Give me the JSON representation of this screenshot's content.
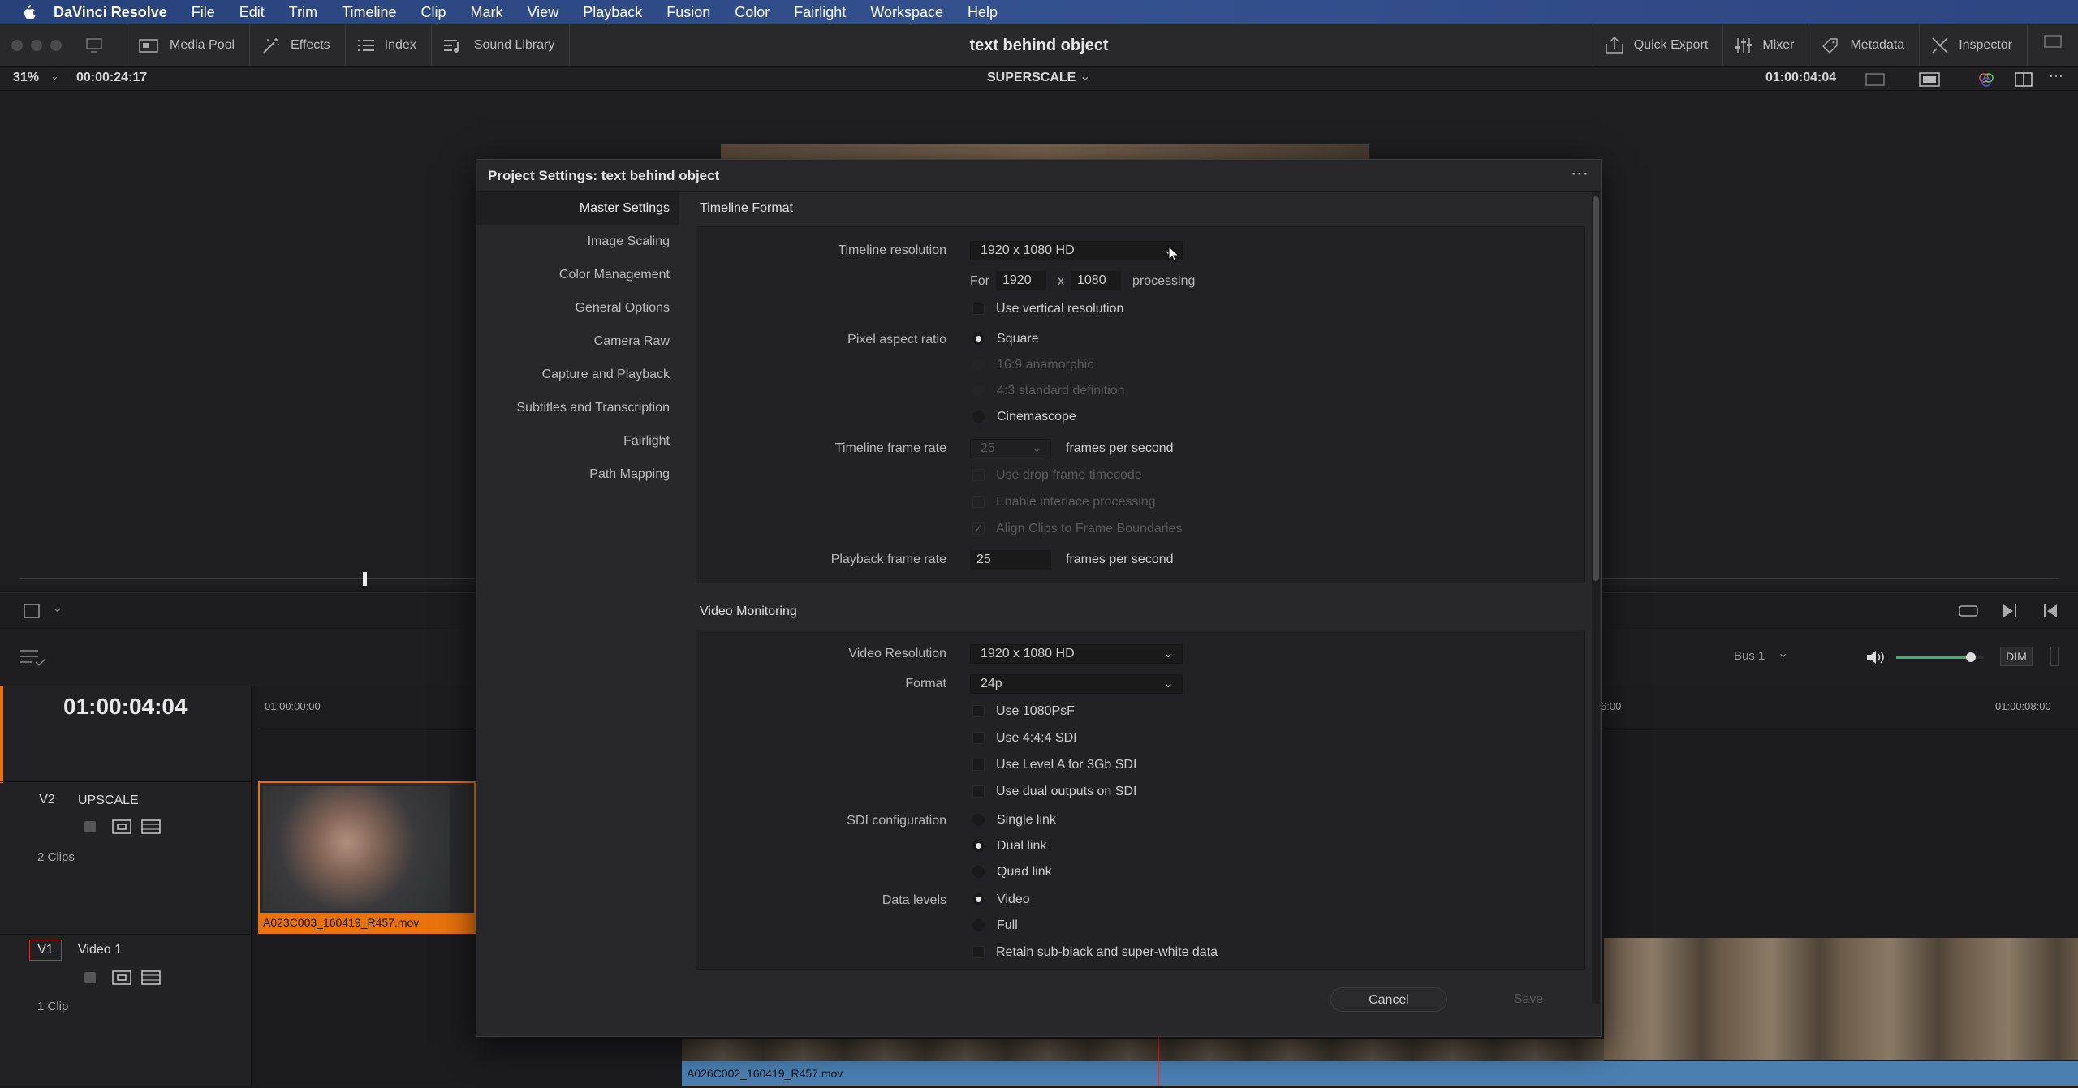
{
  "menubar": {
    "apple_icon": "apple-icon",
    "app": "DaVinci Resolve",
    "items": [
      "File",
      "Edit",
      "Trim",
      "Timeline",
      "Clip",
      "Mark",
      "View",
      "Playback",
      "Fusion",
      "Color",
      "Fairlight",
      "Workspace",
      "Help"
    ]
  },
  "toolbar": {
    "media_pool": "Media Pool",
    "effects": "Effects",
    "index": "Index",
    "sound_library": "Sound Library",
    "title": "text behind object",
    "quick_export": "Quick Export",
    "mixer": "Mixer",
    "metadata": "Metadata",
    "inspector": "Inspector"
  },
  "viewer_bar": {
    "zoom": "31%",
    "duration": "00:00:24:17",
    "clip_name": "SUPERSCALE",
    "timecode": "01:00:04:04"
  },
  "timeline": {
    "timecode": "01:00:04:04",
    "ruler": [
      "01:00:00:00",
      "6:00",
      "01:00:08:00"
    ],
    "bus": "Bus 1",
    "dim": "DIM",
    "volume": 0.85,
    "tracks": [
      {
        "id": "V2",
        "name": "UPSCALE",
        "clips": "2 Clips",
        "clip_file": "A023C003_160419_R457.mov"
      },
      {
        "id": "V1",
        "name": "Video 1",
        "clips": "1 Clip",
        "clip_file": "A026C002_160419_R457.mov"
      }
    ]
  },
  "dialog": {
    "title": "Project Settings:  text behind object",
    "nav": [
      "Master Settings",
      "Image Scaling",
      "Color Management",
      "General Options",
      "Camera Raw",
      "Capture and Playback",
      "Subtitles and Transcription",
      "Fairlight",
      "Path Mapping"
    ],
    "active_nav": "Master Settings",
    "timeline_format": {
      "section": "Timeline Format",
      "resolution_label": "Timeline resolution",
      "resolution_value": "1920 x 1080 HD",
      "for_label": "For",
      "width": "1920",
      "x": "x",
      "height": "1080",
      "processing": "processing",
      "use_vertical": "Use vertical resolution",
      "pixel_aspect_label": "Pixel aspect ratio",
      "pixel_aspect_options": [
        "Square",
        "16:9 anamorphic",
        "4:3 standard definition",
        "Cinemascope"
      ],
      "pixel_aspect_selected": "Square",
      "frame_rate_label": "Timeline frame rate",
      "frame_rate_value": "25",
      "fps": "frames per second",
      "drop_frame": "Use drop frame timecode",
      "interlace": "Enable interlace processing",
      "align_clips": "Align Clips to Frame Boundaries",
      "playback_label": "Playback frame rate",
      "playback_value": "25",
      "playback_fps": "frames per second"
    },
    "video_monitoring": {
      "section": "Video Monitoring",
      "resolution_label": "Video Resolution",
      "resolution_value": "1920 x 1080 HD",
      "format_label": "Format",
      "format_value": "24p",
      "checks": [
        "Use 1080PsF",
        "Use 4:4:4 SDI",
        "Use Level A for 3Gb SDI",
        "Use dual outputs on SDI"
      ],
      "sdi_label": "SDI configuration",
      "sdi_options": [
        "Single link",
        "Dual link",
        "Quad link"
      ],
      "sdi_selected": "Dual link",
      "data_levels_label": "Data levels",
      "data_levels_options": [
        "Video",
        "Full"
      ],
      "data_levels_selected": "Video",
      "retain": "Retain sub-black and super-white data"
    },
    "cancel": "Cancel",
    "save": "Save"
  }
}
